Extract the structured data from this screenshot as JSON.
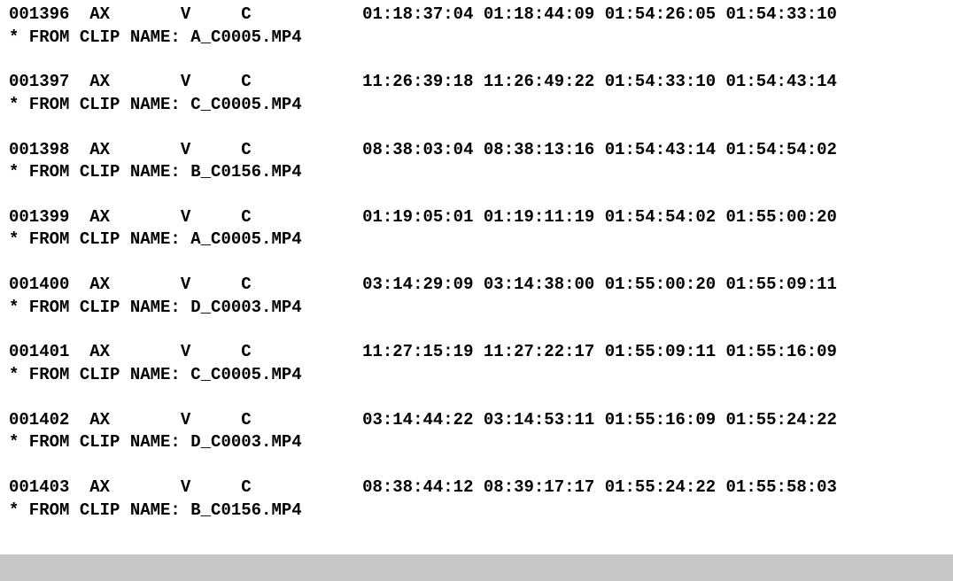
{
  "from_clip_label": "* FROM CLIP NAME: ",
  "entries": [
    {
      "edit_no": "001396",
      "reel": "AX",
      "track": "V",
      "trans": "C",
      "src_in": "01:18:37:04",
      "src_out": "01:18:44:09",
      "rec_in": "01:54:26:05",
      "rec_out": "01:54:33:10",
      "clip": "A_C0005.MP4"
    },
    {
      "edit_no": "001397",
      "reel": "AX",
      "track": "V",
      "trans": "C",
      "src_in": "11:26:39:18",
      "src_out": "11:26:49:22",
      "rec_in": "01:54:33:10",
      "rec_out": "01:54:43:14",
      "clip": "C_C0005.MP4"
    },
    {
      "edit_no": "001398",
      "reel": "AX",
      "track": "V",
      "trans": "C",
      "src_in": "08:38:03:04",
      "src_out": "08:38:13:16",
      "rec_in": "01:54:43:14",
      "rec_out": "01:54:54:02",
      "clip": "B_C0156.MP4"
    },
    {
      "edit_no": "001399",
      "reel": "AX",
      "track": "V",
      "trans": "C",
      "src_in": "01:19:05:01",
      "src_out": "01:19:11:19",
      "rec_in": "01:54:54:02",
      "rec_out": "01:55:00:20",
      "clip": "A_C0005.MP4"
    },
    {
      "edit_no": "001400",
      "reel": "AX",
      "track": "V",
      "trans": "C",
      "src_in": "03:14:29:09",
      "src_out": "03:14:38:00",
      "rec_in": "01:55:00:20",
      "rec_out": "01:55:09:11",
      "clip": "D_C0003.MP4"
    },
    {
      "edit_no": "001401",
      "reel": "AX",
      "track": "V",
      "trans": "C",
      "src_in": "11:27:15:19",
      "src_out": "11:27:22:17",
      "rec_in": "01:55:09:11",
      "rec_out": "01:55:16:09",
      "clip": "C_C0005.MP4"
    },
    {
      "edit_no": "001402",
      "reel": "AX",
      "track": "V",
      "trans": "C",
      "src_in": "03:14:44:22",
      "src_out": "03:14:53:11",
      "rec_in": "01:55:16:09",
      "rec_out": "01:55:24:22",
      "clip": "D_C0003.MP4"
    },
    {
      "edit_no": "001403",
      "reel": "AX",
      "track": "V",
      "trans": "C",
      "src_in": "08:38:44:12",
      "src_out": "08:39:17:17",
      "rec_in": "01:55:24:22",
      "rec_out": "01:55:58:03",
      "clip": "B_C0156.MP4"
    }
  ]
}
